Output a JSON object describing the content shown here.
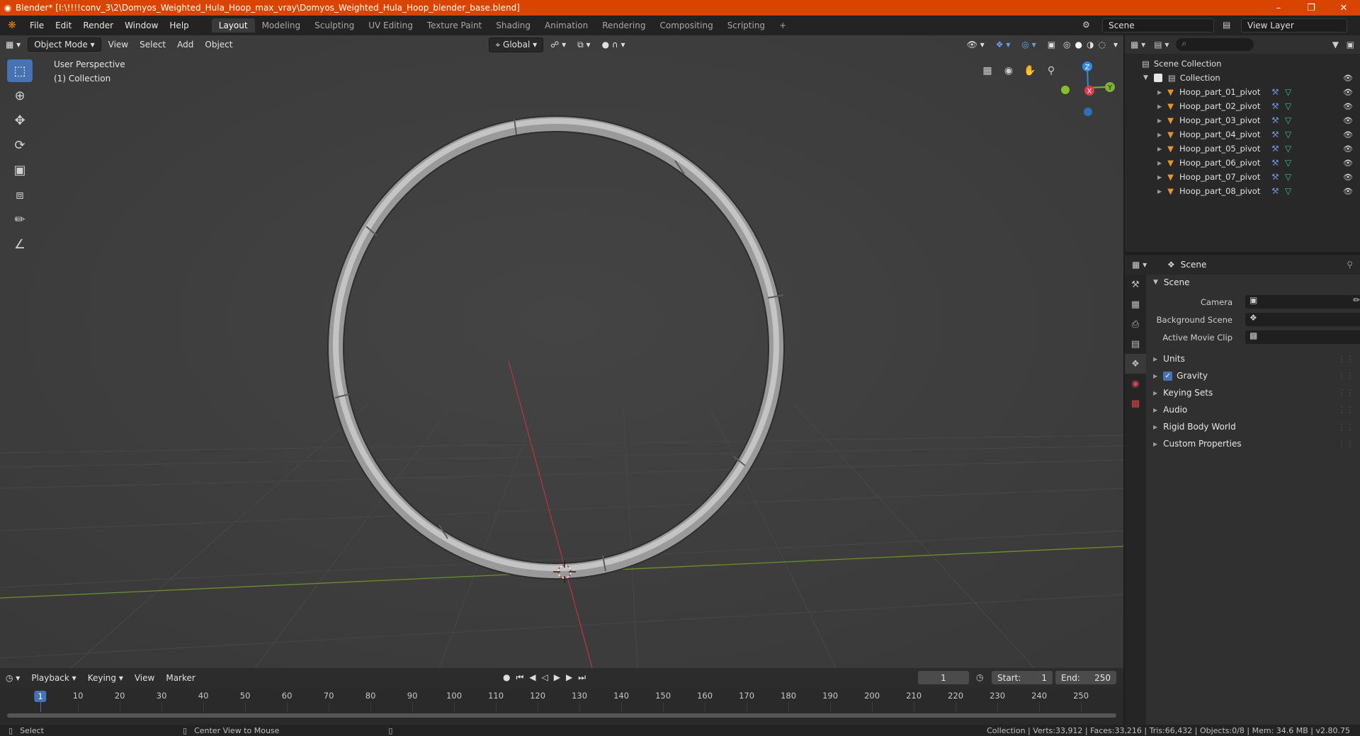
{
  "window": {
    "title": "Blender* [I:\\!!!!conv_3\\2\\Domyos_Weighted_Hula_Hoop_max_vray\\Domyos_Weighted_Hula_Hoop_blender_base.blend]",
    "minimize": "–",
    "maximize": "❐",
    "close": "✕"
  },
  "menu": {
    "items": [
      "File",
      "Edit",
      "Render",
      "Window",
      "Help"
    ],
    "workspaces": [
      "Layout",
      "Modeling",
      "Sculpting",
      "UV Editing",
      "Texture Paint",
      "Shading",
      "Animation",
      "Rendering",
      "Compositing",
      "Scripting"
    ],
    "active_workspace": "Layout",
    "add_tab": "+",
    "scene": "Scene",
    "view_layer": "View Layer"
  },
  "viewport": {
    "mode": "Object Mode",
    "menus": [
      "View",
      "Select",
      "Add",
      "Object"
    ],
    "orientation": "Global",
    "perspective_label": "User Perspective",
    "collection_label": "(1) Collection",
    "gizmo": {
      "z": "Z",
      "x": "X",
      "y": "Y"
    }
  },
  "outliner": {
    "search_placeholder": "⌕",
    "scene_collection": "Scene Collection",
    "collection": "Collection",
    "objects": [
      "Hoop_part_01_pivot",
      "Hoop_part_02_pivot",
      "Hoop_part_03_pivot",
      "Hoop_part_04_pivot",
      "Hoop_part_05_pivot",
      "Hoop_part_06_pivot",
      "Hoop_part_07_pivot",
      "Hoop_part_08_pivot"
    ]
  },
  "properties": {
    "context": "Scene",
    "panel_scene": "Scene",
    "camera_label": "Camera",
    "background_scene_label": "Background Scene",
    "active_movie_clip_label": "Active Movie Clip",
    "panels": [
      "Units",
      "Gravity",
      "Keying Sets",
      "Audio",
      "Rigid Body World",
      "Custom Properties"
    ],
    "gravity_checked": true
  },
  "timeline": {
    "menus": [
      "Playback",
      "Keying",
      "View",
      "Marker"
    ],
    "current_frame": "1",
    "start_label": "Start:",
    "start": "1",
    "end_label": "End:",
    "end": "250",
    "ruler": [
      "1",
      "10",
      "20",
      "30",
      "40",
      "50",
      "60",
      "70",
      "80",
      "90",
      "100",
      "110",
      "120",
      "130",
      "140",
      "150",
      "160",
      "170",
      "180",
      "190",
      "200",
      "210",
      "220",
      "230",
      "240",
      "250"
    ]
  },
  "statusbar": {
    "left": "Select",
    "middle": "Center View to Mouse",
    "stats": "Collection | Verts:33,912 | Faces:33,216 | Tris:66,432 | Objects:0/8 | Mem: 34.6 MB | v2.80.75"
  },
  "colors": {
    "titlebar": "#d94500",
    "accent": "#4772b3",
    "object_orange": "#e8932e",
    "x_axis": "#e0394b",
    "y_axis": "#7fb32f",
    "z_axis": "#2d8ceb"
  }
}
